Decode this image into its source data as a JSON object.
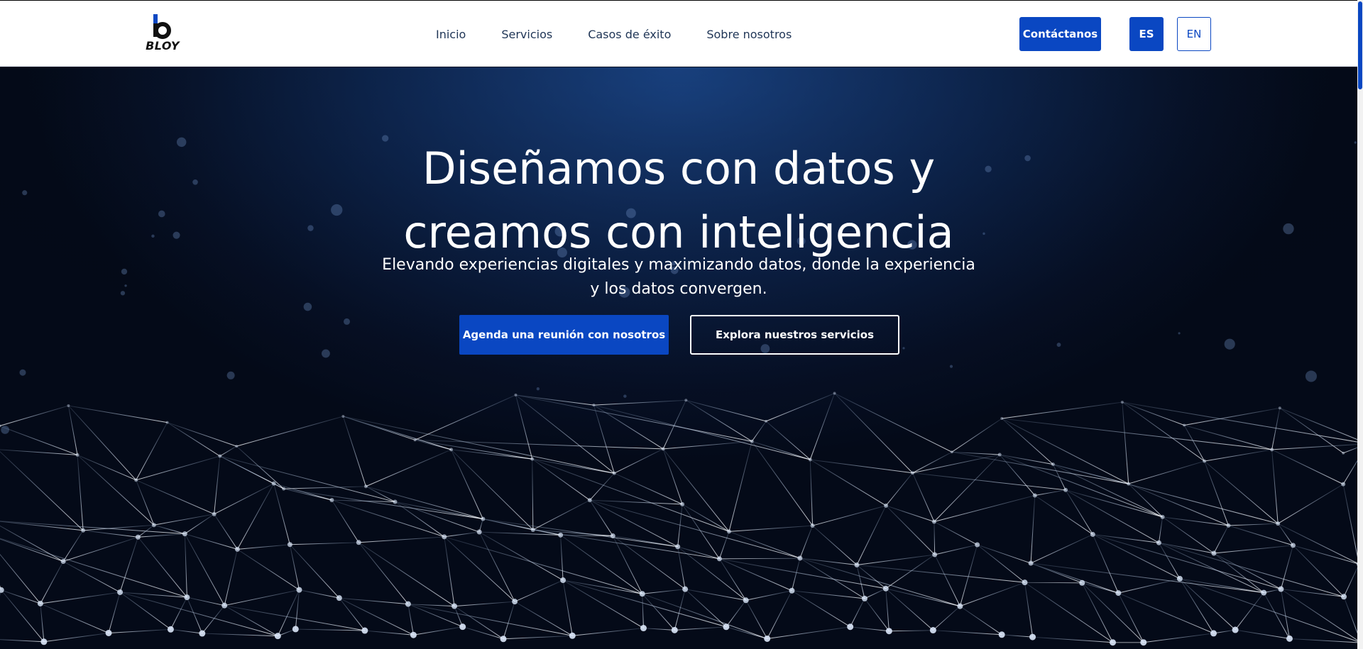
{
  "brand": {
    "name": "BLOY",
    "logo_icon": "bloy-b-logo-icon"
  },
  "nav": {
    "links": [
      "Inicio",
      "Servicios",
      "Casos de éxito",
      "Sobre nosotros"
    ],
    "contact_label": "Contáctanos",
    "lang_es": "ES",
    "lang_en": "EN",
    "active_lang": "ES"
  },
  "hero": {
    "title_line1": "Diseñamos con datos y",
    "title_line2": "creamos con inteligencia",
    "subtitle_line1": "Elevando experiencias digitales y maximizando datos, donde la experiencia",
    "subtitle_line2": "y los datos convergen.",
    "primary_cta": "Agenda una reunión con nosotros",
    "secondary_cta": "Explora nuestros servicios",
    "background": "network-mesh-background"
  },
  "colors": {
    "brand_blue": "#0a47c2",
    "nav_text": "#1f3556",
    "hero_dark": "#060f24"
  }
}
